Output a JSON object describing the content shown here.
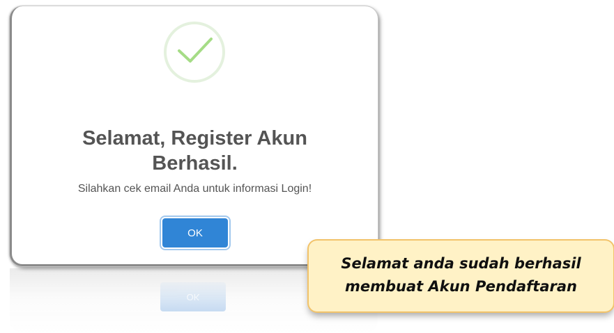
{
  "dialog": {
    "icon": "success-check-icon",
    "title_line1": "Selamat, Register Akun",
    "title_line2": "Berhasil.",
    "message": "Silahkan cek email Anda untuk informasi Login!",
    "ok_label": "OK",
    "reflection_ok_label": "OK"
  },
  "callout": {
    "line1": "Selamat anda sudah berhasil",
    "line2": "membuat Akun Pendaftaran"
  },
  "colors": {
    "button": "#3085d6",
    "success": "#a5dc86",
    "callout_bg": "#fff2c6",
    "callout_border": "#f2c36a",
    "text": "#545454"
  }
}
